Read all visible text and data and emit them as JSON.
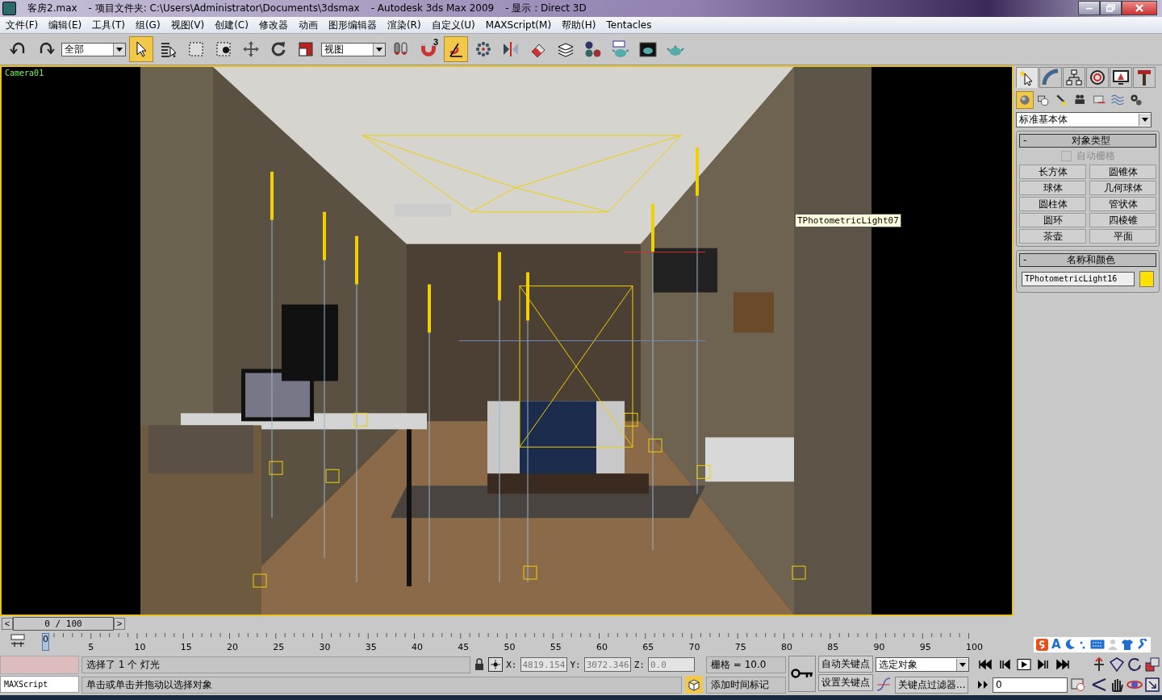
{
  "window": {
    "file": "客房2.max",
    "project": "- 项目文件夹: C:\\Users\\Administrator\\Documents\\3dsmax",
    "app": "- Autodesk 3ds Max  2009",
    "display": "- 显示 : Direct 3D"
  },
  "menu": [
    "文件(F)",
    "编辑(E)",
    "工具(T)",
    "组(G)",
    "视图(V)",
    "创建(C)",
    "修改器",
    "动画",
    "图形编辑器",
    "渲染(R)",
    "自定义(U)",
    "MAXScript(M)",
    "帮助(H)",
    "Tentacles"
  ],
  "toolbar": [
    {
      "kind": "undo",
      "selected": false
    },
    {
      "kind": "redo",
      "selected": false
    },
    {
      "kind": "dropdown",
      "value": "全部"
    },
    {
      "kind": "select",
      "selected": true
    },
    {
      "kind": "select-by-name",
      "selected": false
    },
    {
      "kind": "rect-region",
      "selected": false
    },
    {
      "kind": "window-crossing",
      "selected": false
    },
    {
      "kind": "move",
      "selected": false
    },
    {
      "kind": "rotate",
      "selected": false
    },
    {
      "kind": "scale",
      "selected": false
    },
    {
      "kind": "dropdown",
      "value": "视图"
    },
    {
      "kind": "pivot",
      "selected": false
    },
    {
      "kind": "snap",
      "selected": false,
      "badge": "3"
    },
    {
      "kind": "angle-snap",
      "selected": true
    },
    {
      "kind": "named-sets",
      "selected": false
    },
    {
      "kind": "mirror",
      "selected": false
    },
    {
      "kind": "align",
      "selected": false
    },
    {
      "kind": "layers",
      "selected": false
    },
    {
      "kind": "material",
      "selected": false
    },
    {
      "kind": "render-setup",
      "selected": false
    },
    {
      "kind": "rendered-frame",
      "selected": false
    },
    {
      "kind": "render",
      "selected": false
    }
  ],
  "viewport": {
    "label": "Camera01",
    "tooltip": "TPhotometricLight07"
  },
  "command_panel": {
    "tabs": [
      {
        "kind": "create",
        "selected": true
      },
      {
        "kind": "modify",
        "selected": false
      },
      {
        "kind": "hierarchy",
        "selected": false
      },
      {
        "kind": "motion",
        "selected": false
      },
      {
        "kind": "display",
        "selected": false
      },
      {
        "kind": "utilities",
        "selected": false
      }
    ],
    "subtabs": [
      {
        "kind": "geometry",
        "selected": true
      },
      {
        "kind": "shapes",
        "selected": false
      },
      {
        "kind": "lights",
        "selected": false
      },
      {
        "kind": "cameras",
        "selected": false
      },
      {
        "kind": "helpers",
        "selected": false
      },
      {
        "kind": "spacewarps",
        "selected": false
      },
      {
        "kind": "systems",
        "selected": false
      }
    ],
    "category": "标准基本体",
    "object_type": {
      "collapse": "-",
      "title": "对象类型",
      "autogrid": {
        "label": "自动栅格",
        "checked": false,
        "disabled": true
      },
      "buttons": [
        "长方体",
        "圆锥体",
        "球体",
        "几何球体",
        "圆柱体",
        "管状体",
        "圆环",
        "四棱锥",
        "茶壶",
        "平面"
      ]
    },
    "name_color": {
      "collapse": "-",
      "title": "名称和颜色",
      "name": "TPhotometricLight16",
      "color": "#ffe000"
    }
  },
  "time_slider": {
    "prev": "<",
    "position": "0 / 100",
    "next": ">"
  },
  "track_bar": {
    "labels": [
      "0",
      "5",
      "10",
      "15",
      "20",
      "25",
      "30",
      "35",
      "40",
      "45",
      "50",
      "55",
      "60",
      "65",
      "70",
      "75",
      "80",
      "85",
      "90",
      "95",
      "100"
    ]
  },
  "ime_toolbar": {
    "mode": "A"
  },
  "status": {
    "listener": "MAXScript",
    "prompt": "选择了 1 个 灯光",
    "hint": "单击或单击并拖动以选择对象",
    "coords": [
      {
        "axis": "X:",
        "value": "4819.154"
      },
      {
        "axis": "Y:",
        "value": "3072.346"
      },
      {
        "axis": "Z:",
        "value": "0.0"
      }
    ],
    "grid": "栅格 = 10.0",
    "time_tag": "添加时间标记"
  },
  "animation": {
    "auto_key": "自动关键点",
    "set_key": "设置关键点",
    "key_set": "选定对象",
    "key_filters": "关键点过滤器...",
    "frame": "0"
  }
}
